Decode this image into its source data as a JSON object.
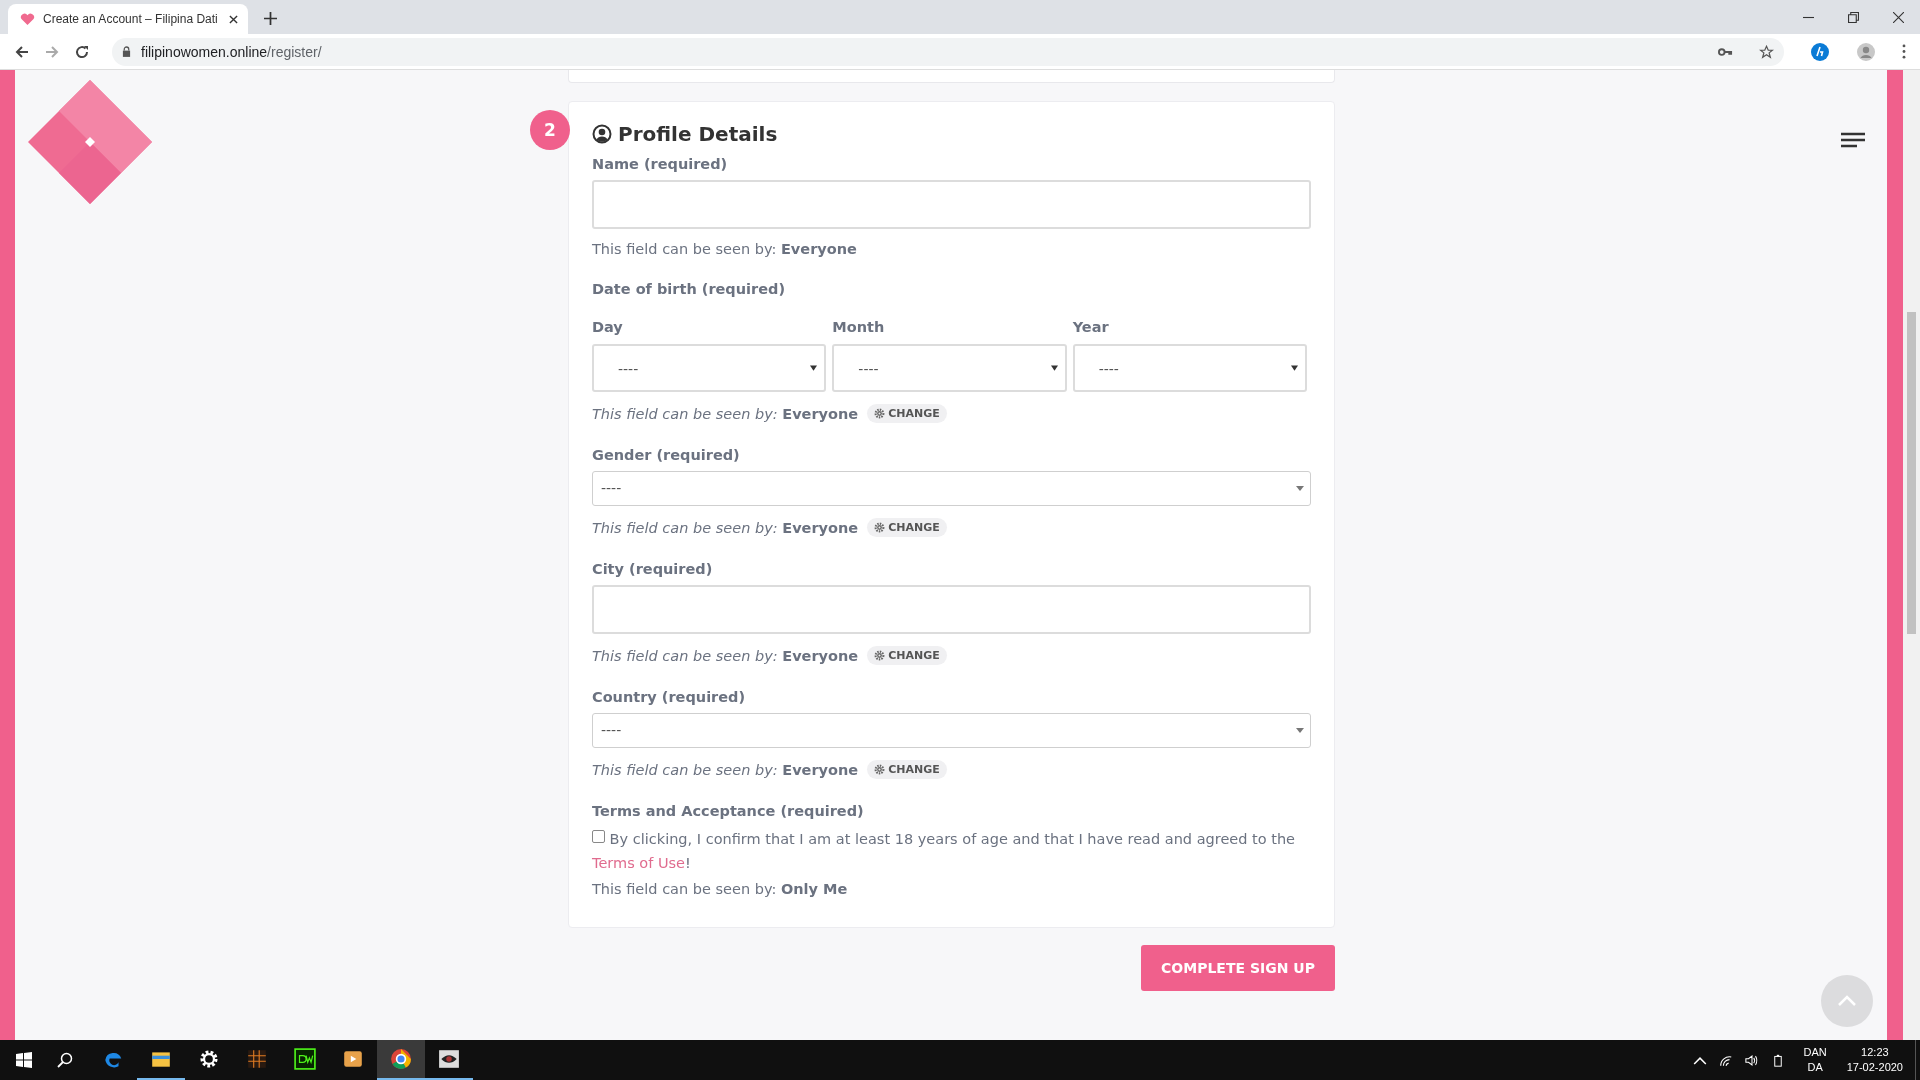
{
  "browser": {
    "tab_title": "Create an Account – Filipina Dati",
    "url_host": "filipinowomen.online",
    "url_path": "/register/"
  },
  "form": {
    "step": "2",
    "title": "Profile Details",
    "fields": [
      {
        "kind": "text",
        "label": "Name (required)",
        "visibility": {
          "prefix": "This field can be seen by:",
          "value": "Everyone"
        }
      },
      {
        "kind": "date",
        "label": "Date of birth (required)",
        "parts": [
          {
            "label": "Day",
            "value": "----"
          },
          {
            "label": "Month",
            "value": "----"
          },
          {
            "label": "Year",
            "value": "----"
          }
        ],
        "visibility": {
          "prefix": "This field can be seen by:",
          "value": "Everyone",
          "change": "CHANGE"
        }
      },
      {
        "kind": "select",
        "label": "Gender (required)",
        "value": "----",
        "visibility": {
          "prefix": "This field can be seen by:",
          "value": "Everyone",
          "change": "CHANGE"
        }
      },
      {
        "kind": "text",
        "label": "City (required)",
        "visibility": {
          "prefix": "This field can be seen by:",
          "value": "Everyone",
          "change": "CHANGE"
        }
      },
      {
        "kind": "select",
        "label": "Country (required)",
        "value": "----",
        "visibility": {
          "prefix": "This field can be seen by:",
          "value": "Everyone",
          "change": "CHANGE"
        }
      },
      {
        "kind": "checkbox",
        "label": "Terms and Acceptance (required)",
        "checked": false,
        "text": "By clicking, I confirm that I am at least 18 years of age and that I have read and agreed to the",
        "link": "Terms of Use",
        "after": "!",
        "visibility": {
          "prefix": "This field can be seen by:",
          "value": "Only Me"
        }
      }
    ],
    "submit": "COMPLETE SIGN UP"
  },
  "taskbar": {
    "apps": [
      {
        "kind": "edge",
        "running": false,
        "selected": false
      },
      {
        "kind": "explorer",
        "running": true,
        "selected": false
      },
      {
        "kind": "settings",
        "running": false,
        "selected": false
      },
      {
        "kind": "grid",
        "running": false,
        "selected": false
      },
      {
        "kind": "dreamweaver",
        "running": false,
        "selected": false
      },
      {
        "kind": "media",
        "running": false,
        "selected": false
      },
      {
        "kind": "chrome",
        "running": true,
        "selected": true
      },
      {
        "kind": "eye",
        "running": true,
        "selected": false
      }
    ],
    "language": [
      "DAN",
      "DA"
    ],
    "time": "12:23",
    "date": "17-02-2020"
  }
}
